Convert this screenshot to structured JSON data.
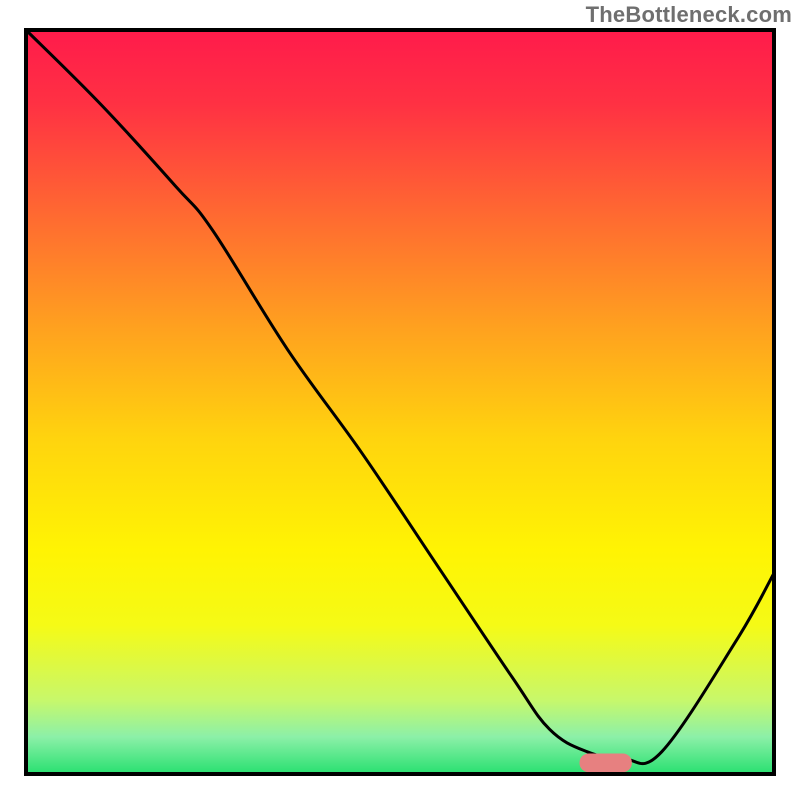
{
  "watermark": "TheBottleneck.com",
  "chart_data": {
    "type": "line",
    "title": "",
    "xlabel": "",
    "ylabel": "",
    "xlim": [
      0,
      100
    ],
    "ylim": [
      0,
      100
    ],
    "background": {
      "type": "vertical-gradient",
      "stops": [
        {
          "offset": 0.0,
          "color": "#ff1b4b"
        },
        {
          "offset": 0.1,
          "color": "#ff3143"
        },
        {
          "offset": 0.25,
          "color": "#ff6a31"
        },
        {
          "offset": 0.4,
          "color": "#ffa11f"
        },
        {
          "offset": 0.55,
          "color": "#ffd40e"
        },
        {
          "offset": 0.7,
          "color": "#fff403"
        },
        {
          "offset": 0.8,
          "color": "#f5fa16"
        },
        {
          "offset": 0.9,
          "color": "#c8f86a"
        },
        {
          "offset": 0.95,
          "color": "#8cf0a8"
        },
        {
          "offset": 1.0,
          "color": "#28e070"
        }
      ]
    },
    "series": [
      {
        "name": "bottleneck-curve",
        "color": "#000000",
        "stroke_width": 3,
        "x": [
          0,
          10,
          20,
          25,
          35,
          45,
          55,
          65,
          70,
          75,
          80,
          85,
          95,
          100
        ],
        "values": [
          100,
          90,
          79,
          73,
          57,
          43,
          28,
          13,
          6,
          3,
          2,
          3,
          18,
          27
        ]
      }
    ],
    "marker": {
      "name": "optimal-marker",
      "color": "#e78080",
      "x_start": 74,
      "x_end": 81,
      "y": 1.5,
      "height": 2.5,
      "corner_radius": 1.2
    },
    "frame": {
      "stroke": "#000000",
      "stroke_width": 4
    }
  }
}
